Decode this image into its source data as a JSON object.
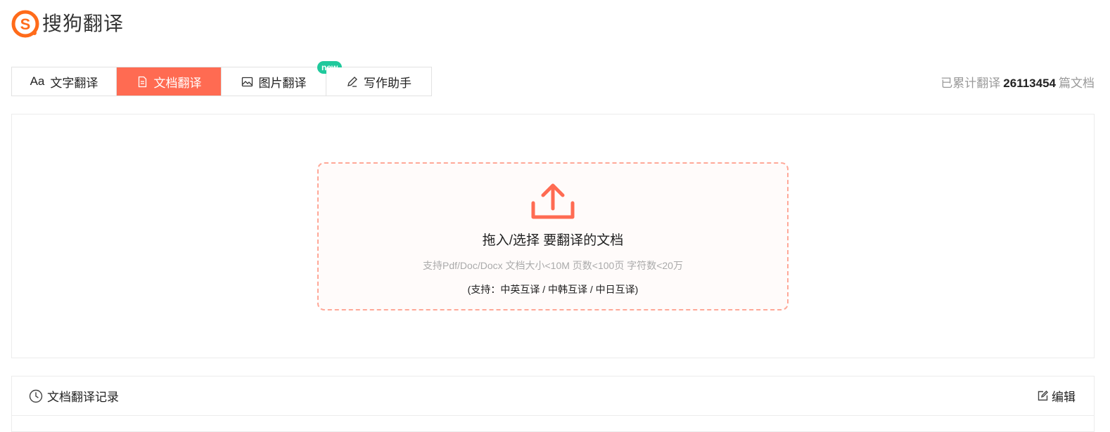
{
  "brand": {
    "name": "搜狗翻译",
    "logo_letter": "S",
    "color": "#ff6b52"
  },
  "tabs": [
    {
      "label": "文字翻译",
      "prefix": "Aa",
      "icon": "text-icon",
      "active": false
    },
    {
      "label": "文档翻译",
      "icon": "document-icon",
      "active": true
    },
    {
      "label": "图片翻译",
      "icon": "image-icon",
      "active": false,
      "badge": "new"
    },
    {
      "label": "写作助手",
      "icon": "pen-icon",
      "active": false
    }
  ],
  "stats": {
    "prefix": "已累计翻译",
    "count": "26113454",
    "suffix": "篇文档"
  },
  "upload": {
    "icon": "upload-icon",
    "title": "拖入/选择 要翻译的文档",
    "hint": "支持Pdf/Doc/Docx 文档大小<10M 页数<100页 字符数<20万",
    "languages": "(支持：中英互译 / 中韩互译 / 中日互译)"
  },
  "history": {
    "icon": "clock-icon",
    "title": "文档翻译记录",
    "edit_label": "编辑",
    "edit_icon": "edit-icon"
  },
  "colors": {
    "accent": "#ff6b52",
    "badge": "#1fc99c",
    "dropzone_border": "#ffa898"
  }
}
